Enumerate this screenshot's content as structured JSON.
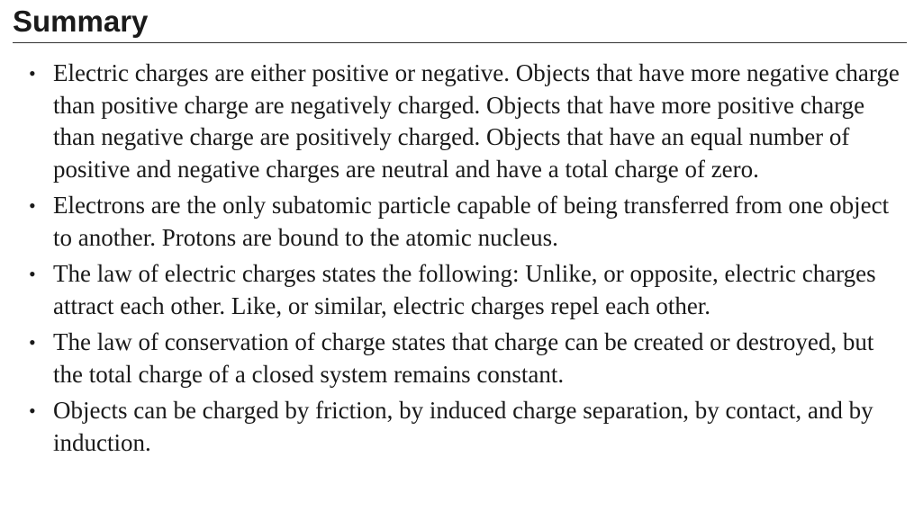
{
  "section": {
    "heading": "Summary"
  },
  "bullets": [
    {
      "marker": "•",
      "text": "Electric charges are either positive or negative. Objects that have more negative charge than positive charge are negatively charged. Objects that have more positive charge than negative charge are positively charged. Objects that have an equal number of positive and negative charges are neutral and have a total charge of zero."
    },
    {
      "marker": "•",
      "text": "Electrons are the only subatomic particle capable of being transferred from one object to another. Protons are bound to the atomic nucleus."
    },
    {
      "marker": "•",
      "text": "The law of electric charges states the following: Unlike, or opposite, electric charges attract each other. Like, or similar, electric charges repel each other."
    },
    {
      "marker": "•",
      "text": "The law of conservation of charge states that charge can be created or destroyed, but the total charge of a closed system remains constant."
    },
    {
      "marker": "•",
      "text": "Objects can be charged by friction, by induced charge separation, by contact, and by induction."
    }
  ]
}
